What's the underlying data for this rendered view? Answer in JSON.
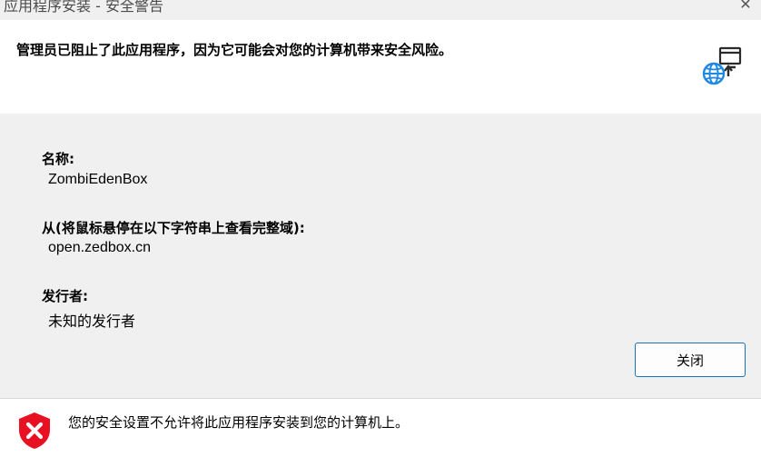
{
  "window": {
    "title": "应用程序安装 - 安全警告",
    "close_glyph": "✕"
  },
  "header": {
    "message": "管理员已阻止了此应用程序，因为它可能会对您的计算机带来安全风险。",
    "icon": "web-install-icon"
  },
  "details": {
    "name_label": "名称:",
    "name_value": "ZombiEdenBox",
    "from_label": "从(将鼠标悬停在以下字符串上查看完整域):",
    "from_value": "open.zedbox.cn",
    "publisher_label": "发行者:",
    "publisher_value": "未知的发行者"
  },
  "buttons": {
    "close_label": "关闭"
  },
  "footer": {
    "message": "您的安全设置不允许将此应用程序安装到您的计算机上。",
    "icon": "shield-error-icon"
  },
  "colors": {
    "accent": "#1f6fb5",
    "globe": "#1e88e5",
    "shield_red": "#e81123",
    "panel_gray": "#f0f0f0"
  }
}
